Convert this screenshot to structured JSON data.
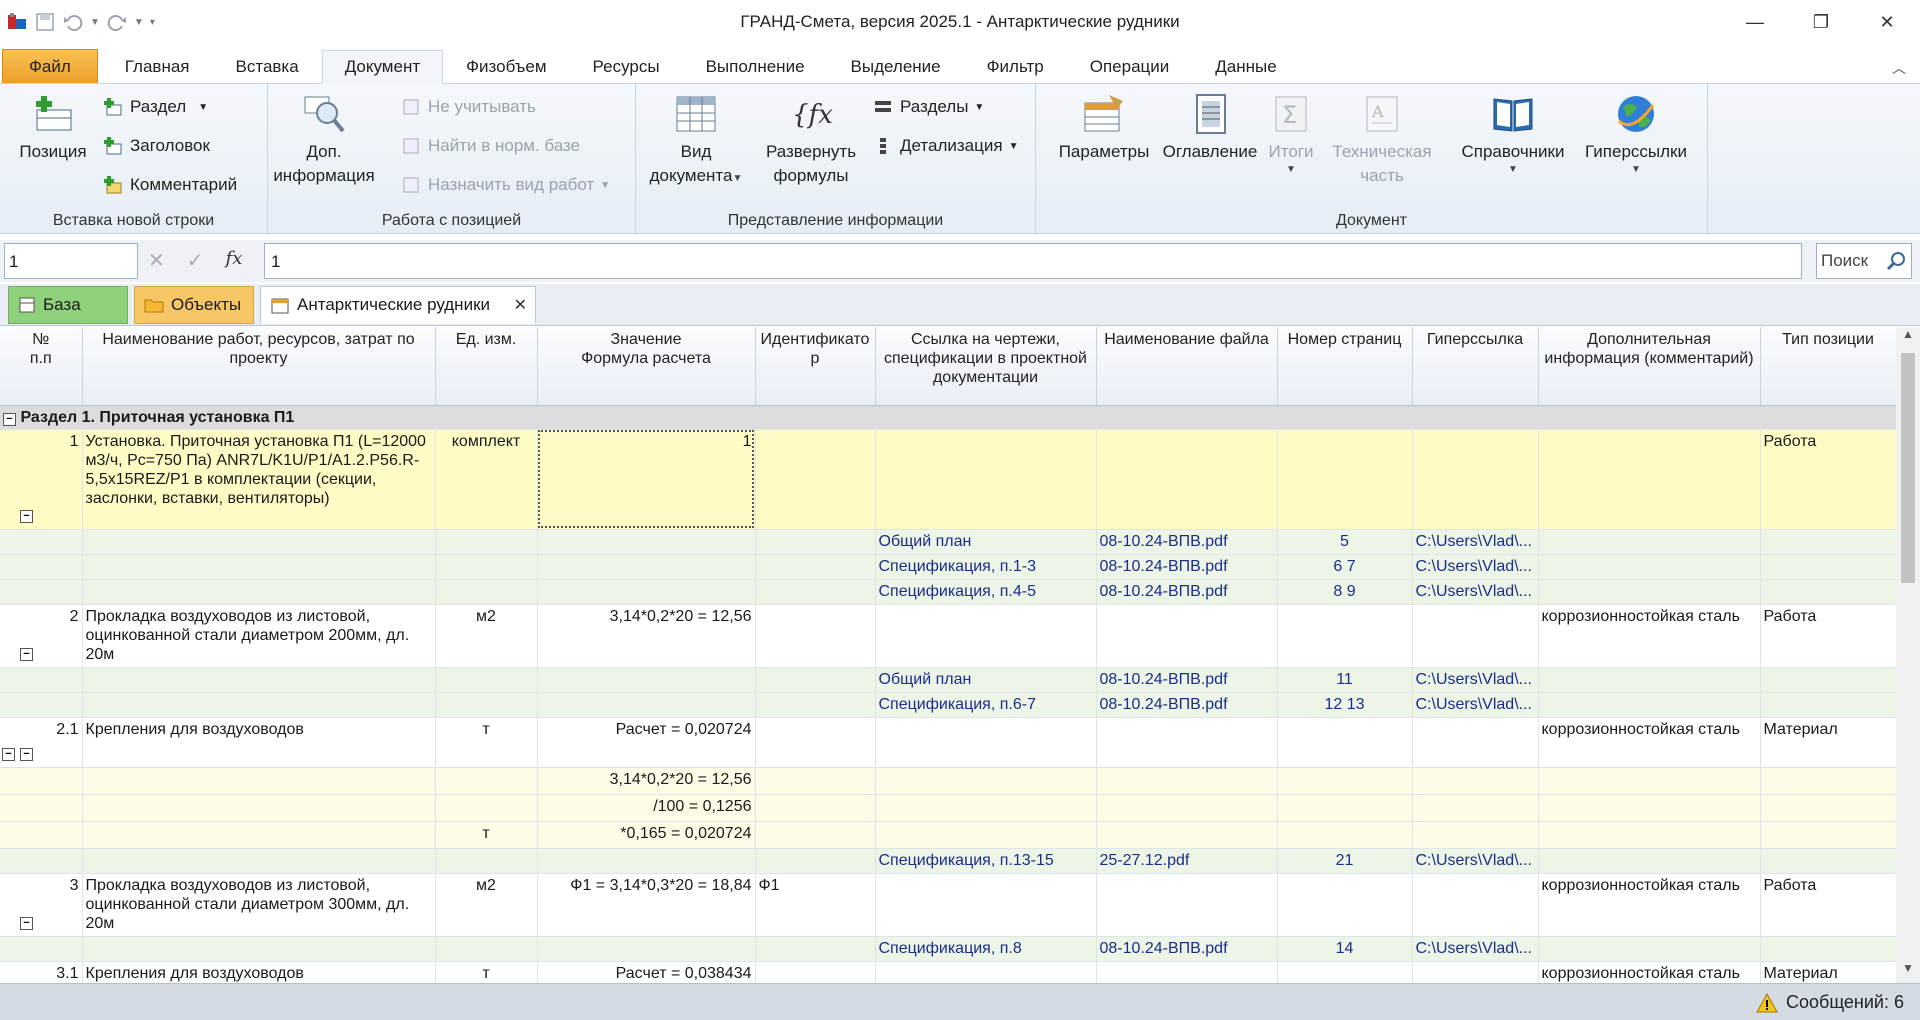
{
  "window": {
    "title": "ГРАНД-Смета, версия 2025.1 - Антарктические рудники"
  },
  "menu": {
    "file": "Файл",
    "tabs": [
      "Главная",
      "Вставка",
      "Документ",
      "Физобъем",
      "Ресурсы",
      "Выполнение",
      "Выделение",
      "Фильтр",
      "Операции",
      "Данные"
    ],
    "active": "Документ"
  },
  "ribbon": {
    "g1": {
      "label": "Вставка новой строки",
      "position": "Позиция",
      "section": "Раздел",
      "header": "Заголовок",
      "comment": "Комментарий"
    },
    "g2": {
      "label": "Работа с позицией",
      "dop_line1": "Доп.",
      "dop_line2": "информация",
      "not_count": "Не учитывать",
      "find_norm": "Найти в норм. базе",
      "assign_work": "Назначить вид работ"
    },
    "g3": {
      "label": "Представление информации",
      "view_line1": "Вид",
      "view_line2": "документа",
      "expand_line1": "Развернуть",
      "expand_line2": "формулы",
      "sections": "Разделы",
      "detail": "Детализация"
    },
    "g4": {
      "label": "Документ",
      "params": "Параметры",
      "toc": "Оглавление",
      "totals": "Итоги",
      "tech_line1": "Техническая",
      "tech_line2": "часть",
      "refs": "Справочники",
      "links": "Гиперссылки"
    }
  },
  "formula_bar": {
    "cell_ref": "1",
    "fx": "fx",
    "value": "1",
    "search_placeholder": "Поиск"
  },
  "doc_tabs": {
    "base": "База",
    "objects": "Объекты",
    "document": "Антарктические рудники"
  },
  "columns": [
    "№\nп.п",
    "Наименование работ, ресурсов, затрат по проекту",
    "Ед. изм.",
    "Значение\nФормула расчета",
    "Идентификатор",
    "Ссылка на чертежи, спецификации в проектной документации",
    "Наименование файла",
    "Номер страниц",
    "Гиперссылка",
    "Дополнительная информация (комментарий)",
    "Тип позиции"
  ],
  "section_title": "Раздел 1. Приточная установка П1",
  "rows": {
    "r1": {
      "num": "1",
      "name": "Установка. Приточная установка  П1 (L=12000 м3/ч, Pc=750 Па) ANR7L/K1U/P1/A1.2.P56.R-5,5x15REZ/P1 в комплектации (секции, заслонки, вставки, вентиляторы)",
      "unit": "комплект",
      "value": "1",
      "type": "Работа"
    },
    "r1a": {
      "link": "Общий план",
      "file": "08-10.24-ВПВ.pdf",
      "pages": "5",
      "href": "C:\\Users\\Vlad\\..."
    },
    "r1b": {
      "link": "Спецификация, п.1-3",
      "file": "08-10.24-ВПВ.pdf",
      "pages": "6 7",
      "href": "C:\\Users\\Vlad\\..."
    },
    "r1c": {
      "link": "Спецификация, п.4-5",
      "file": "08-10.24-ВПВ.pdf",
      "pages": "8 9",
      "href": "C:\\Users\\Vlad\\..."
    },
    "r2": {
      "num": "2",
      "name": "Прокладка воздуховодов из листовой, оцинкованной стали диаметром 200мм, дл. 20м",
      "unit": "м2",
      "value": "3,14*0,2*20 = 12,56",
      "comment": "коррозионностойкая сталь",
      "type": "Работа"
    },
    "r2a": {
      "link": "Общий план",
      "file": "08-10.24-ВПВ.pdf",
      "pages": "11",
      "href": "C:\\Users\\Vlad\\..."
    },
    "r2b": {
      "link": "Спецификация, п.6-7",
      "file": "08-10.24-ВПВ.pdf",
      "pages": "12 13",
      "href": "C:\\Users\\Vlad\\..."
    },
    "r21": {
      "num": "2.1",
      "name": "Крепления для воздуховодов",
      "unit": "т",
      "value": "Расчет = 0,020724",
      "comment": "коррозионностойкая сталь",
      "type": "Материал"
    },
    "f1": {
      "value": "3,14*0,2*20 = 12,56"
    },
    "f2": {
      "value": "/100 = 0,1256"
    },
    "f3": {
      "unit": "т",
      "value": "*0,165 = 0,020724"
    },
    "r21a": {
      "link": "Спецификация, п.13-15",
      "file": "25-27.12.pdf",
      "pages": "21",
      "href": "C:\\Users\\Vlad\\..."
    },
    "r3": {
      "num": "3",
      "name": "Прокладка воздуховодов из листовой, оцинкованной стали диаметром 300мм, дл. 20м",
      "unit": "м2",
      "value": "Ф1 = 3,14*0,3*20 = 18,84",
      "ident": "Ф1",
      "comment": "коррозионностойкая сталь",
      "type": "Работа"
    },
    "r3a": {
      "link": "Спецификация, п.8",
      "file": "08-10.24-ВПВ.pdf",
      "pages": "14",
      "href": "C:\\Users\\Vlad\\..."
    },
    "r31": {
      "num": "3.1",
      "name": "Крепления для воздуховодов",
      "unit": "т",
      "value": "Расчет = 0,038434",
      "comment": "коррозионностойкая сталь",
      "type": "Материал"
    }
  },
  "status": {
    "messages": "Сообщений: 6"
  }
}
